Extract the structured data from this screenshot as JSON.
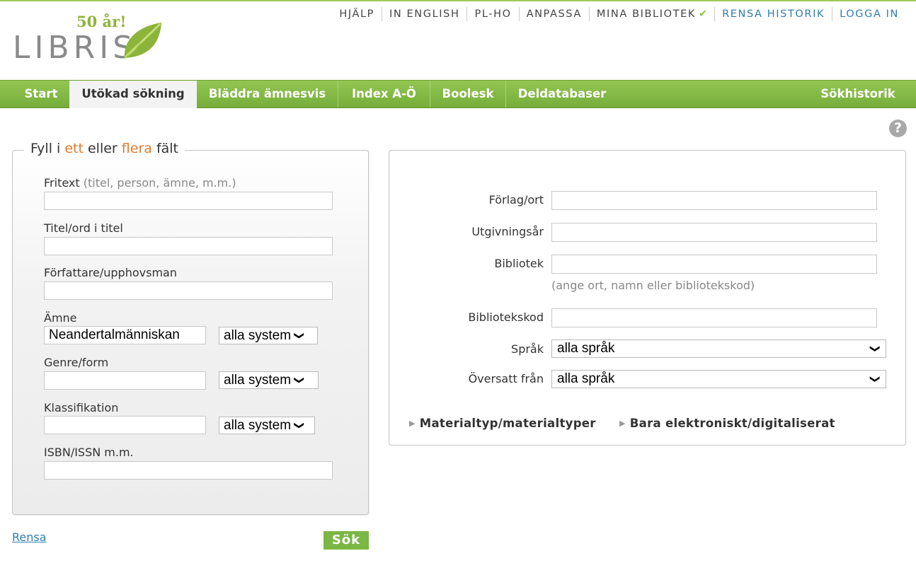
{
  "logo": {
    "anniversary": "50 år!",
    "name": "LIBRIS"
  },
  "toplinks": [
    {
      "label": "HJÄLP"
    },
    {
      "label": "IN ENGLISH"
    },
    {
      "label": "PL-HO"
    },
    {
      "label": "ANPASSA"
    },
    {
      "label": "MINA BIBLIOTEK"
    },
    {
      "label": "RENSA HISTORIK"
    },
    {
      "label": "LOGGA IN"
    }
  ],
  "nav": {
    "start": "Start",
    "utokad": "Utökad sökning",
    "bladdra": "Bläddra ämnesvis",
    "index": "Index A-Ö",
    "boolesk": "Boolesk",
    "deldatabaser": "Deldatabaser",
    "sokhistorik": "Sökhistorik"
  },
  "help": {
    "label": "?"
  },
  "form": {
    "legend": {
      "p1": "Fyll i ",
      "ett": "ett",
      "p2": " eller ",
      "flera": "flera",
      "p3": " fält"
    },
    "fritext": {
      "label": "Fritext",
      "hint": "(titel, person, ämne, m.m.)",
      "value": ""
    },
    "titel": {
      "label": "Titel/ord i titel",
      "value": ""
    },
    "forfattare": {
      "label": "Författare/upphovsman",
      "value": ""
    },
    "amne": {
      "label": "Ämne",
      "value": "Neandertalmänniskan",
      "system": "alla system"
    },
    "genre": {
      "label": "Genre/form",
      "value": "",
      "system": "alla system"
    },
    "klass": {
      "label": "Klassifikation",
      "value": "",
      "system": "alla system"
    },
    "isbn": {
      "label": "ISBN/ISSN m.m.",
      "value": ""
    },
    "rensa": "Rensa",
    "sok": "Sök"
  },
  "right": {
    "forlag": {
      "label": "Förlag/ort"
    },
    "utgivningsar": {
      "label": "Utgivningsår"
    },
    "bibliotek": {
      "label": "Bibliotek",
      "hint": "(ange ort, namn eller bibliotekskod)"
    },
    "bibliotekskod": {
      "label": "Bibliotekskod"
    },
    "sprak": {
      "label": "Språk",
      "value": "alla språk"
    },
    "oversatt": {
      "label": "Översatt från",
      "value": "alla språk"
    },
    "materialtyp": "Materialtyp/materialtyper",
    "elektroniskt": "Bara elektroniskt/digitaliserat"
  },
  "colors": {
    "nav_green": "#7ab744",
    "accent_orange": "#e07a2e",
    "link_blue": "#2f7fae",
    "leaf_green": "#8db43a"
  }
}
